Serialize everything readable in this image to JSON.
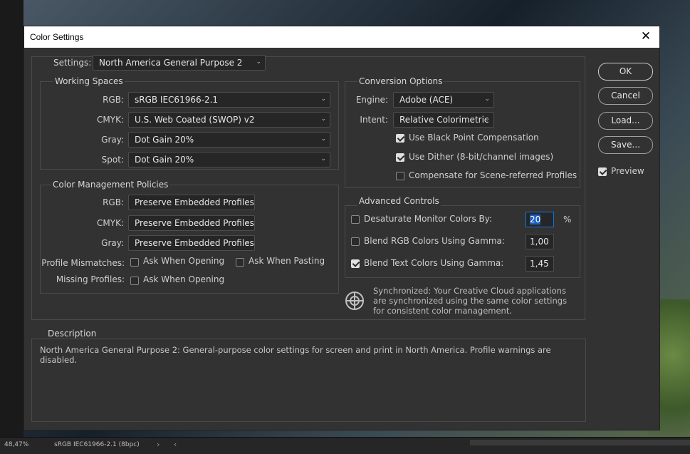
{
  "statusbar": {
    "zoom": "48,47%",
    "profile": "sRGB IEC61966-2.1 (8bpc)",
    "arrows": "› ‹"
  },
  "dialog": {
    "title": "Color Settings",
    "close_glyph": "✕",
    "settings": {
      "label": "Settings:",
      "value": "North America General Purpose 2"
    },
    "working_spaces": {
      "title": "Working Spaces",
      "rgb": {
        "label": "RGB:",
        "value": "sRGB IEC61966-2.1"
      },
      "cmyk": {
        "label": "CMYK:",
        "value": "U.S. Web Coated (SWOP) v2"
      },
      "gray": {
        "label": "Gray:",
        "value": "Dot Gain 20%"
      },
      "spot": {
        "label": "Spot:",
        "value": "Dot Gain 20%"
      }
    },
    "policies": {
      "title": "Color Management Policies",
      "rgb": {
        "label": "RGB:",
        "value": "Preserve Embedded Profiles"
      },
      "cmyk": {
        "label": "CMYK:",
        "value": "Preserve Embedded Profiles"
      },
      "gray": {
        "label": "Gray:",
        "value": "Preserve Embedded Profiles"
      },
      "mismatch_label": "Profile Mismatches:",
      "ask_opening": {
        "label": "Ask When Opening",
        "checked": false
      },
      "ask_pasting": {
        "label": "Ask When Pasting",
        "checked": false
      },
      "missing_label": "Missing Profiles:",
      "missing_ask_opening": {
        "label": "Ask When Opening",
        "checked": false
      }
    },
    "conversion": {
      "title": "Conversion Options",
      "engine": {
        "label": "Engine:",
        "value": "Adobe (ACE)"
      },
      "intent": {
        "label": "Intent:",
        "value": "Relative Colorimetric"
      },
      "black_point": {
        "label": "Use Black Point Compensation",
        "checked": true
      },
      "dither": {
        "label": "Use Dither (8-bit/channel images)",
        "checked": true
      },
      "scene_referred": {
        "label": "Compensate for Scene-referred Profiles",
        "checked": false
      }
    },
    "advanced": {
      "title": "Advanced Controls",
      "desaturate": {
        "label": "Desaturate Monitor Colors By:",
        "value": "20",
        "unit": "%",
        "checked": false
      },
      "blend_rgb": {
        "label": "Blend RGB Colors Using Gamma:",
        "value": "1,00",
        "checked": false
      },
      "blend_text": {
        "label": "Blend Text Colors Using Gamma:",
        "value": "1,45",
        "checked": true
      }
    },
    "sync_text": "Synchronized: Your Creative Cloud applications are synchronized using the same color settings for consistent color management.",
    "description": {
      "title": "Description",
      "text": "North America General Purpose 2:  General-purpose color settings for screen and print in North America. Profile warnings are disabled."
    },
    "buttons": {
      "ok": "OK",
      "cancel": "Cancel",
      "load": "Load...",
      "save": "Save..."
    },
    "preview": {
      "label": "Preview",
      "checked": true
    }
  },
  "colors": {
    "dialog_bg": "#323232",
    "focus": "#1473e6",
    "title_bar": "#ffffff"
  }
}
